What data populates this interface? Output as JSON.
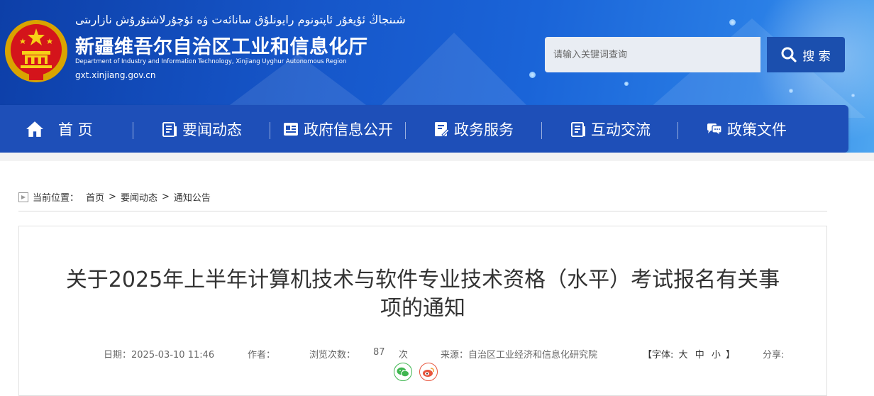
{
  "header": {
    "uyghur_title": "شىنجاڭ ئۇيغۇر ئاپتونوم رايونلۇق سانائەت ۋە ئۇچۇرلاشتۇرۇش نازارىتى",
    "site_name": "新疆维吾尔自治区工业和信息化厅",
    "site_name_en": "Department of Industry and Information Technology, Xinjiang Uyghur Autonomous Region",
    "site_url": "gxt.xinjiang.gov.cn",
    "search_placeholder": "请输入关键词查询",
    "search_button": "搜 索"
  },
  "nav": {
    "items": [
      {
        "label": "首 页",
        "icon": "home-icon"
      },
      {
        "label": "要闻动态",
        "icon": "news-icon"
      },
      {
        "label": "政府信息公开",
        "icon": "document-icon"
      },
      {
        "label": "政务服务",
        "icon": "service-icon"
      },
      {
        "label": "互动交流",
        "icon": "interaction-icon"
      },
      {
        "label": "政策文件",
        "icon": "chat-icon"
      }
    ]
  },
  "breadcrumb": {
    "prefix": "当前位置：",
    "items": [
      "首页",
      "要闻动态",
      "通知公告"
    ],
    "separator": ">"
  },
  "article": {
    "title_line1": "关于2025年上半年计算机技术与软件专业技术资格（水平）考试报名有关事",
    "title_line2": "项的通知",
    "date_label": "日期：",
    "date": "2025-03-10 11:46",
    "author_label": "作者：",
    "author": "",
    "views_label": "浏览次数：",
    "views": "87",
    "views_unit": "次",
    "source_label": "来源：",
    "source": "自治区工业经济和信息化研究院",
    "font_label": "【字体:",
    "font_sizes": [
      "大",
      "中",
      "小"
    ],
    "font_close": "】",
    "share_label": "分享:"
  },
  "colors": {
    "nav_bg": "#1e4fb8",
    "banner_dark": "#0d3fa8",
    "wechat": "#3fb650",
    "weibo": "#e8553d"
  }
}
